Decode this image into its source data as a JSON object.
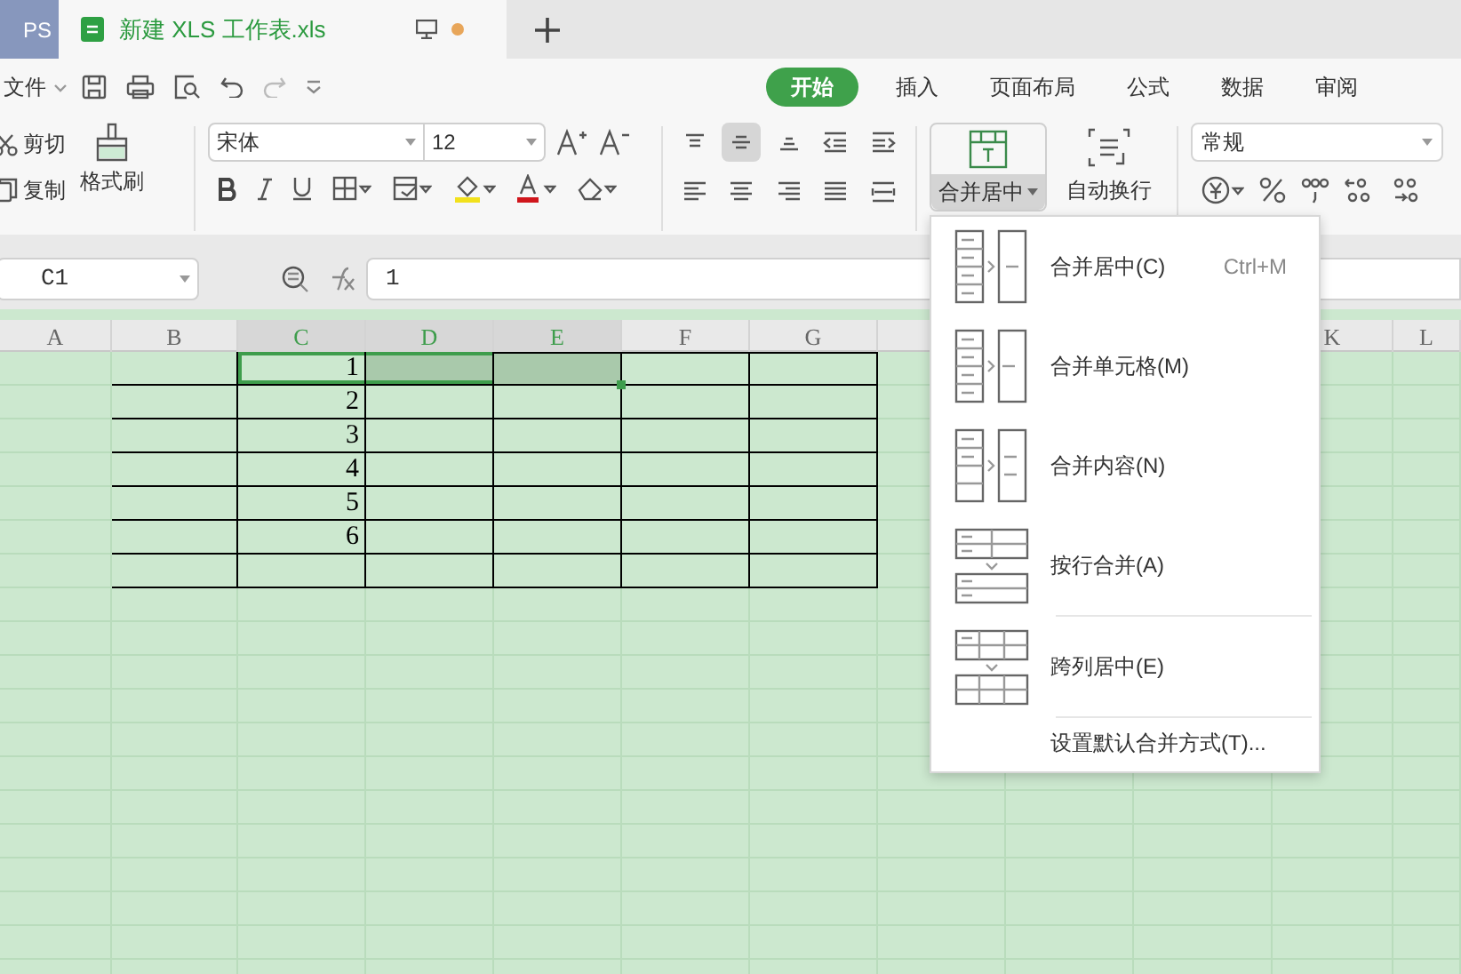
{
  "window_tabs": [
    {
      "label": "PS",
      "selected": false
    },
    {
      "label": "新建 XLS 工作表.xls",
      "selected": true,
      "unsaved": true
    }
  ],
  "file_menu": "文件",
  "ribbon_tabs": [
    {
      "label": "开始",
      "selected": true
    },
    {
      "label": "插入",
      "selected": false
    },
    {
      "label": "页面布局",
      "selected": false
    },
    {
      "label": "公式",
      "selected": false
    },
    {
      "label": "数据",
      "selected": false
    },
    {
      "label": "审阅",
      "selected": false
    }
  ],
  "clipboard": {
    "cut": "剪切",
    "copy": "复制",
    "format_painter": "格式刷"
  },
  "font": {
    "name": "宋体",
    "size": "12"
  },
  "merge_button": {
    "label": "合并居中",
    "pressed": true
  },
  "wrap_button": {
    "label": "自动换行"
  },
  "number_format": "常规",
  "formula_bar": {
    "name_box": "C1",
    "value": "1"
  },
  "columns_left": [
    "A",
    "B",
    "C",
    "D",
    "E",
    "F",
    "G"
  ],
  "columns_right": [
    "K",
    "L"
  ],
  "table": {
    "rows": [
      {
        "value": "1",
        "selected": true
      },
      {
        "value": "2",
        "selected": false
      },
      {
        "value": "3",
        "selected": false
      },
      {
        "value": "4",
        "selected": false
      },
      {
        "value": "5",
        "selected": false
      },
      {
        "value": "6",
        "selected": false
      }
    ]
  },
  "merge_menu": [
    {
      "kind": "merge-center",
      "label": "合并居中(C)",
      "shortcut": "Ctrl+M",
      "separator_before": false
    },
    {
      "kind": "merge-cells",
      "label": "合并单元格(M)",
      "separator_before": false
    },
    {
      "kind": "merge-content",
      "label": "合并内容(N)",
      "separator_before": false
    },
    {
      "kind": "merge-rows",
      "label": "按行合并(A)",
      "separator_before": false
    },
    {
      "kind": "center-across",
      "label": "跨列居中(E)",
      "separator_before": true
    },
    {
      "kind": "setting",
      "label": "设置默认合并方式(T)...",
      "separator_before": true
    }
  ]
}
